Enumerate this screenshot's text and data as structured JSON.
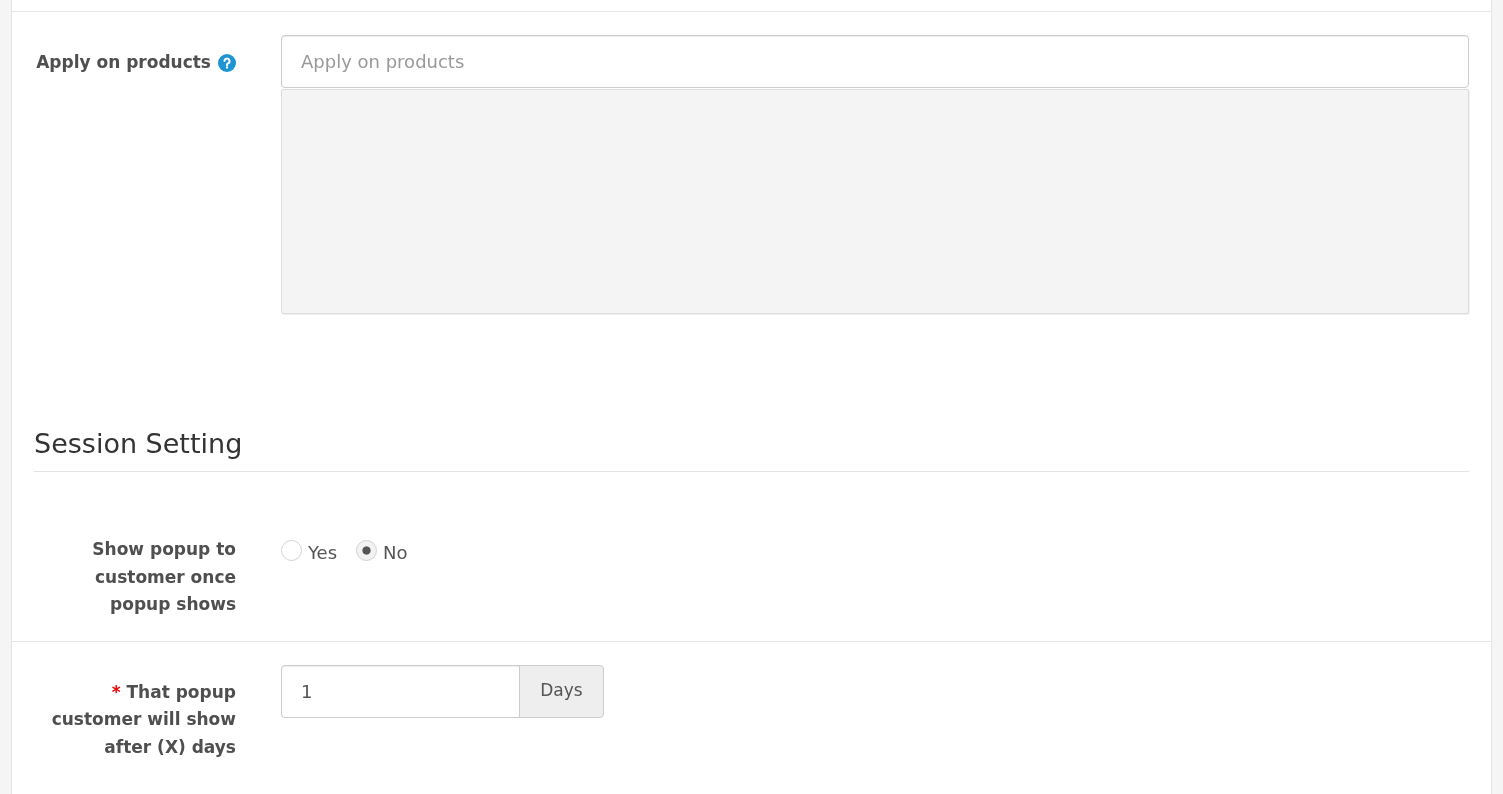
{
  "apply_on_products": {
    "label": "Apply on products",
    "placeholder": "Apply on products"
  },
  "session_setting": {
    "title": "Session Setting",
    "show_once": {
      "label": "Show popup to customer once popup shows",
      "options": [
        {
          "label": "Yes",
          "selected": false
        },
        {
          "label": "No",
          "selected": true
        }
      ]
    },
    "delay": {
      "required_mark": "*",
      "label": "That popup customer will show after (X) days",
      "value": "1",
      "unit": "Days"
    }
  }
}
